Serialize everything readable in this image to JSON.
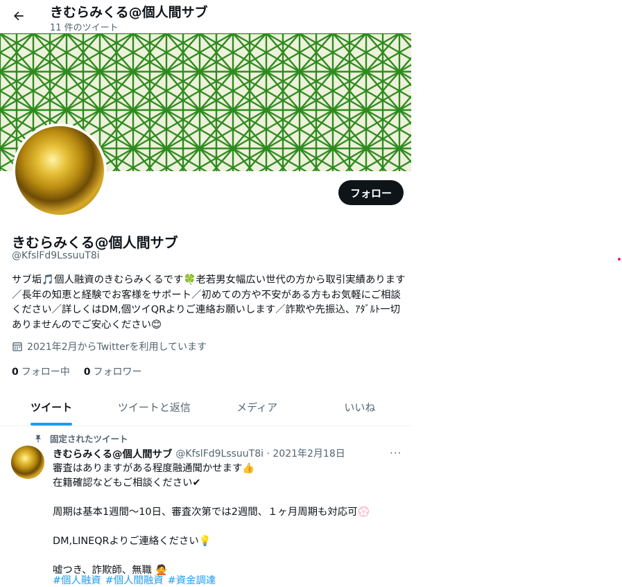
{
  "header": {
    "name": "きむらみくる@個人間サブ",
    "tweet_count": "11 件のツイート"
  },
  "profile": {
    "name": "きむらみくる@個人間サブ",
    "handle": "@KfslFd9LssuuT8i",
    "bio": "サブ垢🎵個人融資のきむらみくるです🍀老若男女幅広い世代の方から取引実績あります／長年の知恵と経験でお客様をサポート／初めての方や不安がある方もお気軽にご相談ください／詳しくはDM,個ツイQRよりご連絡お願いします／詐欺や先振込、ｱﾀﾞﾙﾄ一切ありませんのでご安心ください😊",
    "joined": "2021年2月からTwitterを利用しています",
    "following_count": "0",
    "following_label": "フォロー中",
    "followers_count": "0",
    "followers_label": "フォロワー",
    "follow_button": "フォロー"
  },
  "tabs": [
    {
      "label": "ツイート",
      "active": true
    },
    {
      "label": "ツイートと返信",
      "active": false
    },
    {
      "label": "メディア",
      "active": false
    },
    {
      "label": "いいね",
      "active": false
    }
  ],
  "tweet": {
    "pinned_label": "固定されたツイート",
    "name": "きむらみくる@個人間サブ",
    "meta": "@KfslFd9LssuuT8i · 2021年2月18日",
    "more": "···",
    "body": "審査はありますがある程度融通聞かせます👍\n在籍確認などもご相談ください✔\n\n周期は基本1週間〜10日、審査次第では2週間、１ヶ月周期も対応可💮\n\nDM,LINEQRよりご連絡ください💡\n\n嘘つき、詐欺師、無職 🙅",
    "hashtags": [
      "#個人融資",
      "#個人間融資",
      "#資金調達"
    ]
  },
  "colors": {
    "accent": "#1d9bf0",
    "text": "#0f1419",
    "muted": "#536471",
    "banner_bg": "#eef2dc",
    "banner_line": "#2e8a1e"
  },
  "icons": {
    "back": "arrow-left-icon",
    "calendar": "calendar-icon",
    "pin": "pin-icon",
    "more": "more-icon"
  }
}
